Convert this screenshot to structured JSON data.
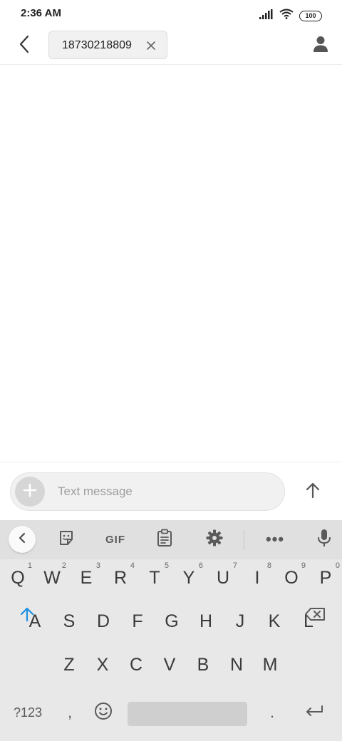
{
  "status_bar": {
    "time": "2:36 AM",
    "battery": "100"
  },
  "app_bar": {
    "recipient_chip": "18730218809"
  },
  "compose": {
    "placeholder": "Text message"
  },
  "keyboard": {
    "toolbar": {
      "gif_label": "GIF",
      "more_label": "•••"
    },
    "row1": [
      {
        "key": "Q",
        "hint": "1"
      },
      {
        "key": "W",
        "hint": "2"
      },
      {
        "key": "E",
        "hint": "3"
      },
      {
        "key": "R",
        "hint": "4"
      },
      {
        "key": "T",
        "hint": "5"
      },
      {
        "key": "Y",
        "hint": "6"
      },
      {
        "key": "U",
        "hint": "7"
      },
      {
        "key": "I",
        "hint": "8"
      },
      {
        "key": "O",
        "hint": "9"
      },
      {
        "key": "P",
        "hint": "0"
      }
    ],
    "row2": [
      "A",
      "S",
      "D",
      "F",
      "G",
      "H",
      "J",
      "K",
      "L"
    ],
    "row3": [
      "Z",
      "X",
      "C",
      "V",
      "B",
      "N",
      "M"
    ],
    "bottom": {
      "symbols": "?123",
      "comma": ",",
      "period": "."
    }
  },
  "colors": {
    "accent": "#1a8fe3",
    "icon": "#5a5a5a",
    "keyboard_bg": "#e8e8e8"
  }
}
